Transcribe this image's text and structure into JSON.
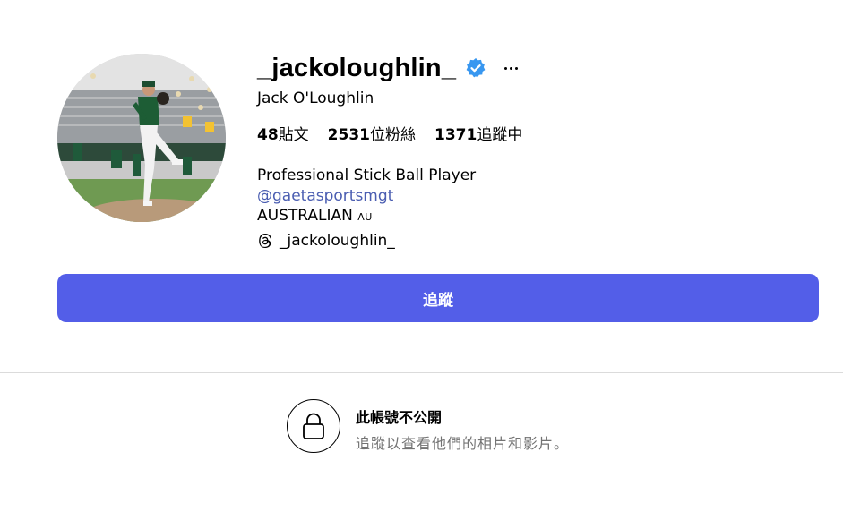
{
  "profile": {
    "username": "_jackoloughlin_",
    "full_name": "Jack O'Loughlin",
    "verified_icon": "verified-badge-icon",
    "more_icon": "more-options-icon"
  },
  "stats": {
    "posts_count": "48",
    "posts_label": "貼文",
    "followers_count": "2531",
    "followers_label": "位粉絲",
    "following_count": "1371",
    "following_label": "追蹤中"
  },
  "bio": {
    "line1": "Professional Stick Ball Player",
    "mention": "@gaetasportsmgt",
    "line3": "AUSTRALIAN",
    "flag": "AU",
    "threads_handle": "_jackoloughlin_"
  },
  "actions": {
    "follow_label": "追蹤"
  },
  "private_notice": {
    "title": "此帳號不公開",
    "subtitle": "追蹤以查看他們的相片和影片。"
  },
  "colors": {
    "follow_button": "#535ee8",
    "mention_link": "#4a5db1",
    "verified_badge": "#3897f0",
    "secondary_text": "#737373"
  }
}
